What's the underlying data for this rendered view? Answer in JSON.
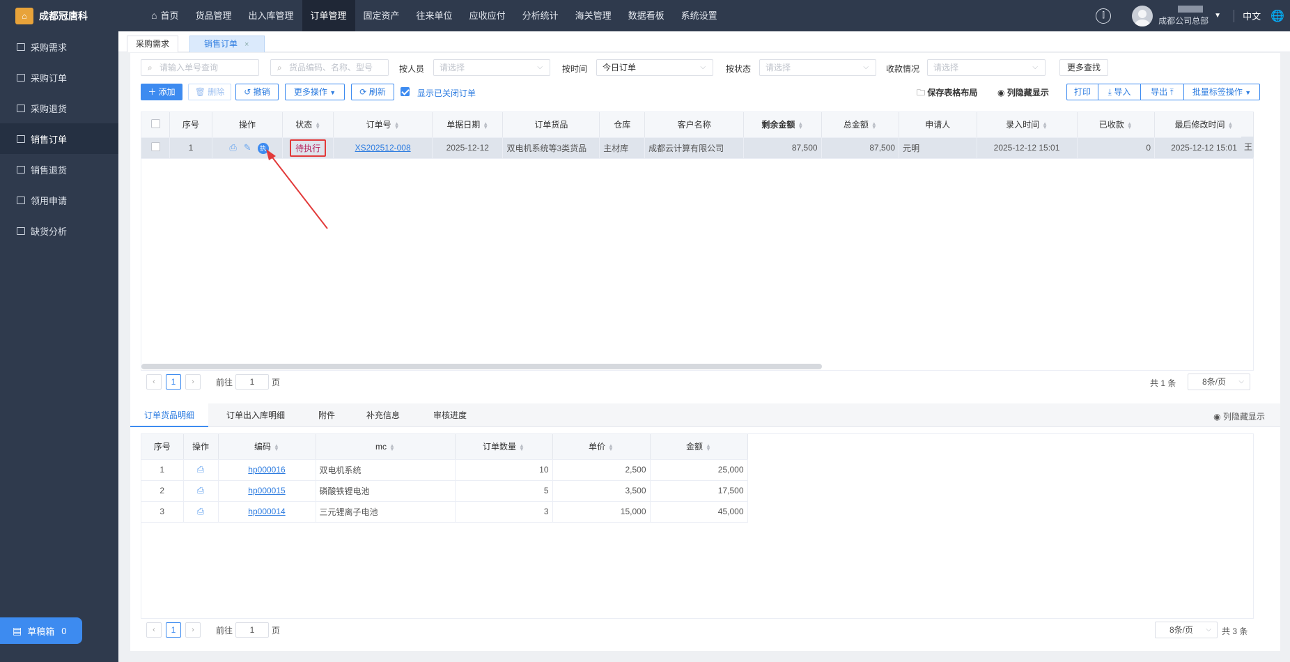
{
  "app": {
    "company": "成都冠唐科",
    "logo_glyph": "⌂"
  },
  "topnav": {
    "items": [
      {
        "label": "首页",
        "icon": "home-icon"
      },
      {
        "label": "货品管理"
      },
      {
        "label": "出入库管理"
      },
      {
        "label": "订单管理",
        "active": true
      },
      {
        "label": "固定资产"
      },
      {
        "label": "往来单位"
      },
      {
        "label": "应收应付"
      },
      {
        "label": "分析统计"
      },
      {
        "label": "海关管理"
      },
      {
        "label": "数据看板"
      },
      {
        "label": "系统设置"
      }
    ],
    "user_org": "成都公司总部",
    "lang": "中文",
    "icons": [
      "split-icon",
      "user-avatar",
      "caret-down-icon",
      "globe-icon"
    ]
  },
  "sidebar": {
    "items": [
      {
        "label": "采购需求",
        "icon": "cart-icon"
      },
      {
        "label": "采购订单",
        "icon": "cart-icon"
      },
      {
        "label": "采购退货",
        "icon": "cart-icon"
      },
      {
        "label": "销售订单",
        "icon": "bag-icon",
        "active": true
      },
      {
        "label": "销售退货",
        "icon": "bag-icon"
      },
      {
        "label": "领用申请",
        "icon": "briefcase-icon"
      },
      {
        "label": "缺货分析",
        "icon": "cart-icon"
      }
    ],
    "draft": {
      "label": "草稿箱",
      "count": "0"
    }
  },
  "page_tabs": [
    {
      "label": "采购需求"
    },
    {
      "label": "销售订单",
      "active": true,
      "close": "×"
    }
  ],
  "filters": {
    "order_no_placeholder": "请输入单号查询",
    "goods_placeholder": "货品编码、名称、型号",
    "person_label": "按人员",
    "person_placeholder": "请选择",
    "time_label": "按时间",
    "time_value": "今日订单",
    "status_label": "按状态",
    "status_placeholder": "请选择",
    "payment_label": "收款情况",
    "payment_placeholder": "请选择",
    "more_search": "更多查找"
  },
  "toolbar": {
    "add": "添加",
    "delete": "删除",
    "revoke": "撤销",
    "more_ops": "更多操作",
    "refresh": "刷新",
    "show_closed": "显示已关闭订单",
    "save_layout": "保存表格布局",
    "col_toggle": "列隐藏显示",
    "print": "打印",
    "import": "导入",
    "export": "导出",
    "batch_label": "批量标签操作"
  },
  "orders": {
    "columns": [
      "序号",
      "操作",
      "状态",
      "订单号",
      "单据日期",
      "订单货品",
      "仓库",
      "客户名称",
      "剩余金额",
      "总金额",
      "申请人",
      "录入时间",
      "已收款",
      "最后修改时间"
    ],
    "rows": [
      {
        "index": "1",
        "status": "待执行",
        "exec_icon_label": "执",
        "order_no": "XS202512-008",
        "date": "2025-12-12",
        "goods": "双电机系统等3类货品",
        "warehouse": "主材库",
        "customer": "成都云计算有限公司",
        "remaining": "87,500",
        "total": "87,500",
        "applicant": "元明",
        "entered": "2025-12-12 15:01",
        "received": "0",
        "modified": "2025-12-12 15:01",
        "extra": "王"
      }
    ],
    "pager": {
      "page": "1",
      "goto_prefix": "前往",
      "goto_value": "1",
      "goto_suffix": "页",
      "total": "共 1 条",
      "page_size": "8条/页"
    }
  },
  "detail_tabs": {
    "tabs": [
      "订单货品明细",
      "订单出入库明细",
      "附件",
      "补充信息",
      "审核进度"
    ],
    "col_toggle": "列隐藏显示"
  },
  "details": {
    "columns": [
      "序号",
      "操作",
      "编码",
      "mc",
      "订单数量",
      "单价",
      "金额"
    ],
    "rows": [
      {
        "index": "1",
        "code": "hp000016",
        "name": "双电机系统",
        "qty": "10",
        "price": "2,500",
        "amount": "25,000"
      },
      {
        "index": "2",
        "code": "hp000015",
        "name": "磷酸铁锂电池",
        "qty": "5",
        "price": "3,500",
        "amount": "17,500"
      },
      {
        "index": "3",
        "code": "hp000014",
        "name": "三元锂离子电池",
        "qty": "3",
        "price": "15,000",
        "amount": "45,000"
      }
    ],
    "pager": {
      "page": "1",
      "goto_prefix": "前往",
      "goto_value": "1",
      "goto_suffix": "页",
      "page_size": "8条/页",
      "total": "共 3 条"
    }
  },
  "colors": {
    "accent": "#3d8bf0",
    "annotation": "#e23a3a",
    "nav_bg": "#2f3a4d"
  }
}
